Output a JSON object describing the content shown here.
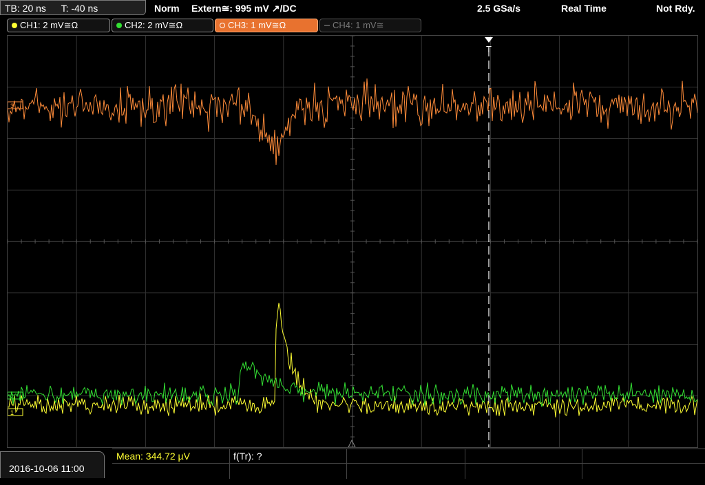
{
  "topbar": {
    "timebase": "TB: 20 ns",
    "trigger_time": "T: -40 ns",
    "trigger_mode": "Norm",
    "trigger_source": "Extern≅: 995 mV ↗/DC",
    "sample_rate": "2.5 GSa/s",
    "acq_mode": "Real Time",
    "status": "Not Rdy."
  },
  "channels": [
    {
      "label": "CH1: 2 mV≅Ω",
      "color": "#ffff33"
    },
    {
      "label": "CH2: 2 mV≅Ω",
      "color": "#33e033"
    },
    {
      "label": "CH3: 1 mV≅Ω",
      "color": "#ff8c3a"
    },
    {
      "label": "CH4: 1 mV≅",
      "color": "#777777"
    }
  ],
  "markers": {
    "trigger": "T",
    "ch3": "3",
    "ch2": "2",
    "ch1": "1"
  },
  "measurements": {
    "mean": "Mean: 344.72 µV",
    "rise": "f(Tr): ?"
  },
  "datetime": "2016-10-06 11:00",
  "colors": {
    "ch1": "#ffff33",
    "ch2": "#33e033",
    "ch3": "#ff8c3a",
    "grid": "#3a3a3a",
    "trigger_line": "#ffffff"
  }
}
